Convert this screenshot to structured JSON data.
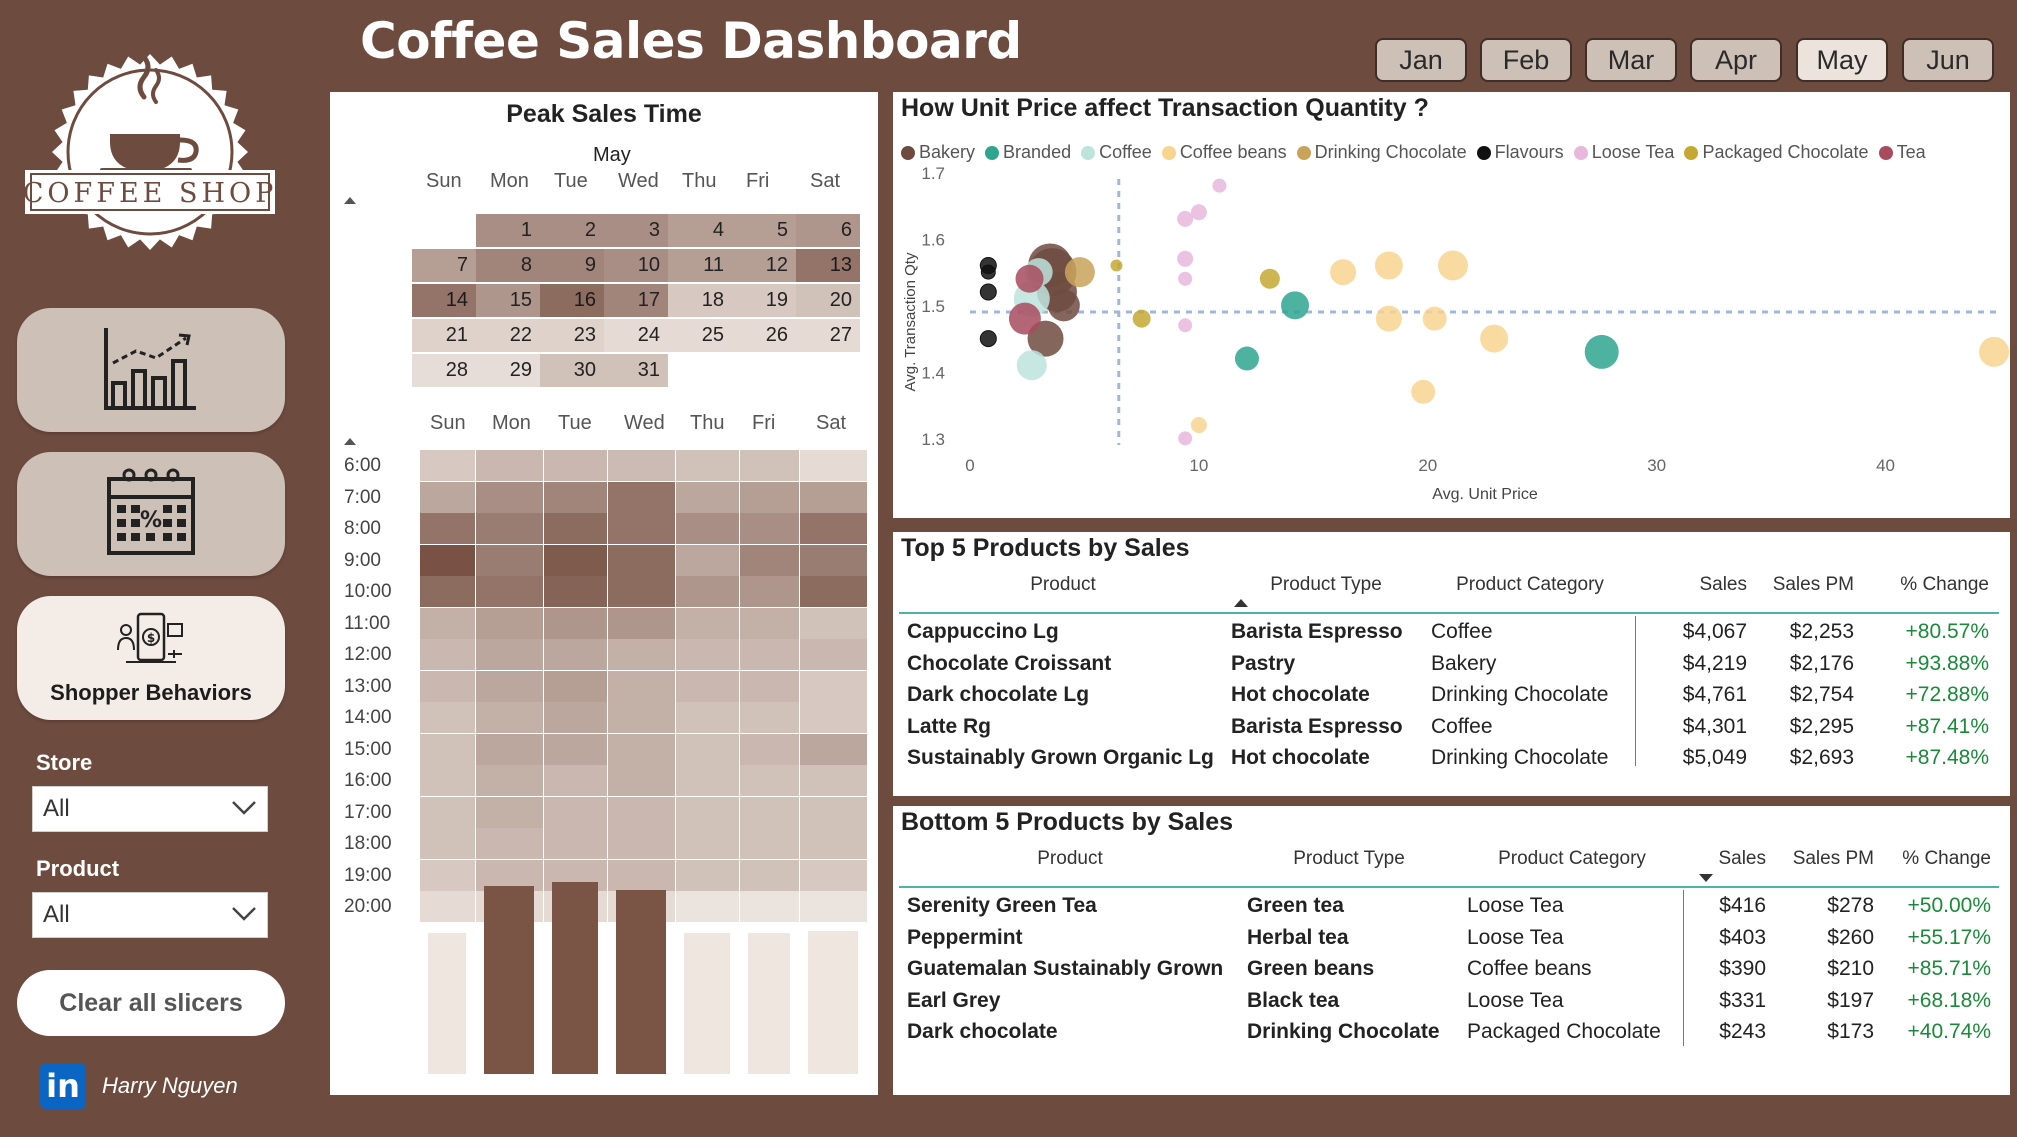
{
  "header": {
    "title": "Coffee Sales Dashboard"
  },
  "months": [
    "Jan",
    "Feb",
    "Mar",
    "Apr",
    "May",
    "Jun"
  ],
  "active_month": "May",
  "sidebar": {
    "logo_text": "COFFEE SHOP",
    "nav": [
      {
        "name": "sales-overview",
        "icon": "bar-chart-icon"
      },
      {
        "name": "calendar",
        "icon": "calendar-icon"
      },
      {
        "name": "shopper-behaviors",
        "icon": "shopper-icon",
        "label": "Shopper Behaviors"
      }
    ],
    "store_label": "Store",
    "store_value": "All",
    "product_label": "Product",
    "product_value": "All",
    "clear_label": "Clear all slicers",
    "author": "Harry Nguyen",
    "linkedin_label": "in"
  },
  "peak": {
    "title": "Peak Sales Time",
    "month_label": "May",
    "weekdays": [
      "Sun",
      "Mon",
      "Tue",
      "Wed",
      "Thu",
      "Fri",
      "Sat"
    ],
    "calendar": [
      [
        null,
        1,
        2,
        3,
        4,
        5,
        6
      ],
      [
        7,
        8,
        9,
        10,
        11,
        12,
        13
      ],
      [
        14,
        15,
        16,
        17,
        18,
        19,
        20
      ],
      [
        21,
        22,
        23,
        24,
        25,
        26,
        27
      ],
      [
        28,
        29,
        30,
        31,
        null,
        null,
        null
      ]
    ],
    "calendar_intensity": [
      [
        null,
        0.55,
        0.55,
        0.55,
        0.45,
        0.45,
        0.5
      ],
      [
        0.45,
        0.6,
        0.6,
        0.55,
        0.45,
        0.45,
        0.7
      ],
      [
        0.7,
        0.5,
        0.75,
        0.6,
        0.2,
        0.2,
        0.25
      ],
      [
        0.15,
        0.15,
        0.15,
        0.1,
        0.1,
        0.1,
        0.1
      ],
      [
        0.08,
        0.08,
        0.25,
        0.25,
        null,
        null,
        null
      ]
    ],
    "hours": [
      "6:00",
      "7:00",
      "8:00",
      "9:00",
      "10:00",
      "11:00",
      "12:00",
      "13:00",
      "14:00",
      "15:00",
      "16:00",
      "17:00",
      "18:00",
      "19:00",
      "20:00"
    ],
    "heatmap": [
      [
        0.2,
        0.3,
        0.3,
        0.28,
        0.25,
        0.25,
        0.1
      ],
      [
        0.4,
        0.55,
        0.6,
        0.7,
        0.4,
        0.45,
        0.45
      ],
      [
        0.7,
        0.65,
        0.75,
        0.7,
        0.55,
        0.55,
        0.7
      ],
      [
        0.9,
        0.65,
        0.85,
        0.75,
        0.4,
        0.6,
        0.65
      ],
      [
        0.75,
        0.7,
        0.8,
        0.75,
        0.5,
        0.5,
        0.75
      ],
      [
        0.35,
        0.45,
        0.5,
        0.5,
        0.35,
        0.35,
        0.25
      ],
      [
        0.3,
        0.4,
        0.4,
        0.35,
        0.3,
        0.3,
        0.3
      ],
      [
        0.3,
        0.4,
        0.45,
        0.35,
        0.3,
        0.3,
        0.2
      ],
      [
        0.25,
        0.35,
        0.4,
        0.35,
        0.25,
        0.25,
        0.2
      ],
      [
        0.25,
        0.4,
        0.4,
        0.35,
        0.25,
        0.3,
        0.4
      ],
      [
        0.25,
        0.35,
        0.3,
        0.35,
        0.25,
        0.25,
        0.25
      ],
      [
        0.25,
        0.35,
        0.3,
        0.3,
        0.25,
        0.25,
        0.25
      ],
      [
        0.25,
        0.3,
        0.3,
        0.3,
        0.25,
        0.25,
        0.25
      ],
      [
        0.2,
        0.3,
        0.3,
        0.3,
        0.25,
        0.25,
        0.2
      ],
      [
        0.1,
        0.1,
        0.1,
        0.1,
        0.05,
        0.05,
        0.05
      ]
    ],
    "weekday_totals": [
      0.75,
      1.0,
      1.02,
      0.98,
      0.75,
      0.75,
      0.76
    ]
  },
  "scatter": {
    "title": "How Unit Price affect Transaction Quantity ?",
    "xlabel": "Avg. Unit Price",
    "ylabel": "Avg. Transaction Qty",
    "xticks": [
      "0",
      "10",
      "20",
      "30",
      "40"
    ],
    "yticks": [
      "1.7",
      "1.6",
      "1.5",
      "1.4",
      "1.3"
    ]
  },
  "chart_data": {
    "type": "scatter",
    "title": "How Unit Price affect Transaction Quantity ?",
    "xlabel": "Avg. Unit Price",
    "ylabel": "Avg. Transaction Qty",
    "xlim": [
      0,
      45
    ],
    "ylim": [
      1.3,
      1.7
    ],
    "ref_x": 6.5,
    "ref_y": 1.515,
    "legend_position": "top",
    "series": [
      {
        "name": "Bakery",
        "color": "#6e4b3f",
        "points": [
          [
            3.6,
            1.56,
            24
          ],
          [
            3.8,
            1.53,
            20
          ],
          [
            3.3,
            1.46,
            18
          ],
          [
            4.1,
            1.51,
            16
          ],
          [
            3.5,
            1.57,
            22
          ]
        ]
      },
      {
        "name": "Branded",
        "color": "#2fa48f",
        "points": [
          [
            14.2,
            1.51,
            14
          ],
          [
            12.1,
            1.43,
            12
          ],
          [
            27.6,
            1.44,
            17
          ]
        ]
      },
      {
        "name": "Coffee",
        "color": "#bde3dd",
        "points": [
          [
            2.7,
            1.52,
            18
          ],
          [
            2.7,
            1.42,
            15
          ],
          [
            3.0,
            1.56,
            14
          ]
        ]
      },
      {
        "name": "Coffee beans",
        "color": "#f8d48f",
        "points": [
          [
            16.3,
            1.56,
            13
          ],
          [
            18.3,
            1.57,
            14
          ],
          [
            21.1,
            1.57,
            15
          ],
          [
            18.3,
            1.49,
            13
          ],
          [
            20.3,
            1.49,
            12
          ],
          [
            22.9,
            1.46,
            14
          ],
          [
            19.8,
            1.38,
            12
          ],
          [
            44.8,
            1.44,
            15
          ],
          [
            10.0,
            1.33,
            8
          ]
        ]
      },
      {
        "name": "Drinking Chocolate",
        "color": "#c9a35a",
        "points": [
          [
            4.8,
            1.56,
            15
          ]
        ]
      },
      {
        "name": "Flavours",
        "color": "#111111",
        "points": [
          [
            0.8,
            1.57,
            8
          ],
          [
            0.8,
            1.53,
            8
          ],
          [
            0.8,
            1.46,
            8
          ],
          [
            0.8,
            1.56,
            7
          ]
        ]
      },
      {
        "name": "Loose Tea",
        "color": "#e8b7dc",
        "points": [
          [
            10.9,
            1.69,
            7
          ],
          [
            9.4,
            1.64,
            8
          ],
          [
            10.0,
            1.65,
            8
          ],
          [
            9.4,
            1.58,
            8
          ],
          [
            9.4,
            1.55,
            7
          ],
          [
            9.4,
            1.48,
            7
          ],
          [
            9.4,
            1.31,
            7
          ]
        ]
      },
      {
        "name": "Packaged Chocolate",
        "color": "#c4a832",
        "points": [
          [
            13.1,
            1.55,
            10
          ],
          [
            7.5,
            1.49,
            9
          ],
          [
            6.4,
            1.57,
            6
          ]
        ]
      },
      {
        "name": "Tea",
        "color": "#a84b5e",
        "points": [
          [
            2.4,
            1.49,
            16
          ],
          [
            2.6,
            1.55,
            14
          ]
        ]
      }
    ]
  },
  "top5": {
    "title": "Top 5 Products by Sales",
    "columns": [
      "Product",
      "Product Type",
      "Product Category",
      "Sales",
      "Sales PM",
      "% Change"
    ],
    "rows": [
      [
        "Cappuccino Lg",
        "Barista Espresso",
        "Coffee",
        "$4,067",
        "$2,253",
        "+80.57%"
      ],
      [
        "Chocolate Croissant",
        "Pastry",
        "Bakery",
        "$4,219",
        "$2,176",
        "+93.88%"
      ],
      [
        "Dark chocolate Lg",
        "Hot chocolate",
        "Drinking Chocolate",
        "$4,761",
        "$2,754",
        "+72.88%"
      ],
      [
        "Latte Rg",
        "Barista Espresso",
        "Coffee",
        "$4,301",
        "$2,295",
        "+87.41%"
      ],
      [
        "Sustainably Grown Organic Lg",
        "Hot chocolate",
        "Drinking Chocolate",
        "$5,049",
        "$2,693",
        "+87.48%"
      ]
    ]
  },
  "bottom5": {
    "title": "Bottom 5 Products by Sales",
    "columns": [
      "Product",
      "Product Type",
      "Product Category",
      "Sales",
      "Sales PM",
      "% Change"
    ],
    "rows": [
      [
        "Serenity Green Tea",
        "Green tea",
        "Loose Tea",
        "$416",
        "$278",
        "+50.00%"
      ],
      [
        "Peppermint",
        "Herbal tea",
        "Loose Tea",
        "$403",
        "$260",
        "+55.17%"
      ],
      [
        "Guatemalan Sustainably Grown",
        "Green beans",
        "Coffee beans",
        "$390",
        "$210",
        "+85.71%"
      ],
      [
        "Earl Grey",
        "Black tea",
        "Loose Tea",
        "$331",
        "$197",
        "+68.18%"
      ],
      [
        "Dark chocolate",
        "Drinking Chocolate",
        "Packaged Chocolate",
        "$243",
        "$173",
        "+40.74%"
      ]
    ]
  },
  "colors": {
    "background": "#6e4b3f",
    "heat_low": "#f2ebe6",
    "heat_high": "#6b4133",
    "accent_line": "#4fb3a3",
    "positive": "#1a8a3a"
  }
}
